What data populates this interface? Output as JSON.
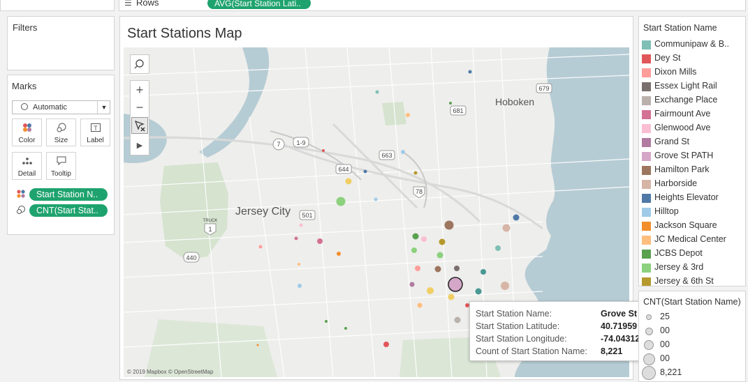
{
  "shelf": {
    "rows_label": "Rows",
    "rows_pill": "AVG(Start Station Lati.."
  },
  "filters": {
    "title": "Filters"
  },
  "marks": {
    "title": "Marks",
    "type": "Automatic",
    "buttons": [
      "Color",
      "Size",
      "Label",
      "Detail",
      "Tooltip"
    ],
    "pills": [
      "Start Station N..",
      "CNT(Start Stat.."
    ]
  },
  "map": {
    "title": "Start Stations Map",
    "labels": [
      "Hoboken",
      "Jersey City"
    ],
    "road_shields": [
      "7",
      "1-9",
      "644",
      "663",
      "681",
      "679",
      "78",
      "501",
      "440",
      "1",
      "TRUCK"
    ],
    "attribution": "© 2019 Mapbox © OpenStreetMap"
  },
  "color_legend": {
    "title": "Start Station Name",
    "items": [
      {
        "label": "Communipaw & B..",
        "color": "#7fbfb5"
      },
      {
        "label": "Dey St",
        "color": "#e15759"
      },
      {
        "label": "Dixon Mills",
        "color": "#ff9d9a"
      },
      {
        "label": "Essex Light Rail",
        "color": "#79706e"
      },
      {
        "label": "Exchange Place",
        "color": "#bab0ac"
      },
      {
        "label": "Fairmount Ave",
        "color": "#d37295"
      },
      {
        "label": "Glenwood Ave",
        "color": "#fabfd2"
      },
      {
        "label": "Grand St",
        "color": "#b07aa1"
      },
      {
        "label": "Grove St PATH",
        "color": "#d4a6c8"
      },
      {
        "label": "Hamilton Park",
        "color": "#9d7660"
      },
      {
        "label": "Harborside",
        "color": "#d7b5a6"
      },
      {
        "label": "Heights Elevator",
        "color": "#4e79a7"
      },
      {
        "label": "Hilltop",
        "color": "#a0cbe8"
      },
      {
        "label": "Jackson Square",
        "color": "#f28e2b"
      },
      {
        "label": "JC Medical Center",
        "color": "#ffbe7d"
      },
      {
        "label": "JCBS Depot",
        "color": "#59a14f"
      },
      {
        "label": "Jersey & 3rd",
        "color": "#8cd17d"
      },
      {
        "label": "Jersey & 6th St",
        "color": "#b6992d"
      }
    ]
  },
  "size_legend": {
    "title": "CNT(Start Station Name)",
    "items": [
      "25",
      "00",
      "00",
      "00",
      "8,221"
    ]
  },
  "tooltip": {
    "rows": [
      {
        "key": "Start Station Name:",
        "value": "Grove St PATH"
      },
      {
        "key": "Start Station Latitude:",
        "value": "40.71959"
      },
      {
        "key": "Start Station Longitude:",
        "value": "-74.04312"
      },
      {
        "key": "Count of Start Station Name:",
        "value": "8,221"
      }
    ]
  },
  "points": [
    {
      "station": "Hilltop",
      "color": "#a0cbe8",
      "count": 120
    },
    {
      "station": "Heights Elevator",
      "color": "#4e79a7",
      "count": 150
    },
    {
      "station": "Jersey & 6th St",
      "color": "#b6992d",
      "count": 900
    },
    {
      "station": "Hamilton Park",
      "color": "#9d7660",
      "count": 3200
    },
    {
      "station": "Grove St PATH",
      "color": "#d4a6c8",
      "count": 8221
    },
    {
      "station": "Exchange Place",
      "color": "#bab0ac",
      "count": 2100
    },
    {
      "station": "JCBS Depot",
      "color": "#59a14f",
      "count": 2600
    },
    {
      "station": "Dey St",
      "color": "#e15759",
      "count": 400
    }
  ]
}
